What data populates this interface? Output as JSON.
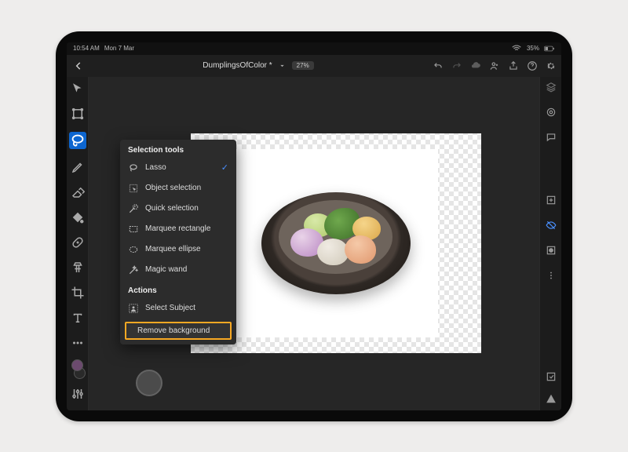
{
  "status": {
    "time": "10:54 AM",
    "date": "Mon 7 Mar",
    "wifi": "wifi",
    "battery": "35%"
  },
  "header": {
    "doc_title": "DumplingsOfColor *",
    "zoom": "27%"
  },
  "popup": {
    "section_tools": "Selection tools",
    "tools": {
      "lasso": "Lasso",
      "object": "Object selection",
      "quick": "Quick selection",
      "marquee_rect": "Marquee rectangle",
      "marquee_ell": "Marquee ellipse",
      "wand": "Magic wand"
    },
    "section_actions": "Actions",
    "actions": {
      "subject": "Select Subject",
      "remove_bg": "Remove background"
    },
    "selected": "lasso"
  }
}
